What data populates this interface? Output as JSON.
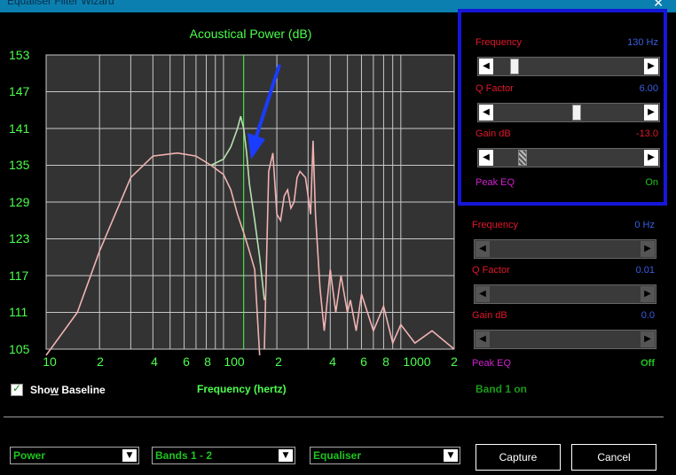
{
  "window": {
    "title": "Equaliser Filter Wizard",
    "close": "✕"
  },
  "chart": {
    "title": "Acoustical Power (dB)",
    "xlabel": "Frequency (hertz)",
    "yticks": [
      "153",
      "147",
      "141",
      "135",
      "129",
      "123",
      "117",
      "111",
      "105"
    ],
    "xticks": [
      "10",
      "2",
      "4",
      "6",
      "8",
      "100",
      "2",
      "4",
      "6",
      "8",
      "1000",
      "2"
    ]
  },
  "chart_data": {
    "type": "line",
    "title": "Acoustical Power (dB)",
    "xlabel": "Frequency (hertz)",
    "ylabel": "",
    "x_scale": "log",
    "xlim": [
      10,
      2000
    ],
    "ylim": [
      105,
      153
    ],
    "grid": true,
    "marker_frequency": 130,
    "series": [
      {
        "color": "#f2b2b2",
        "x": [
          10,
          15,
          20,
          30,
          40,
          55,
          70,
          85,
          100,
          110,
          120,
          130,
          140,
          150,
          160
        ],
        "y": [
          104,
          111,
          121,
          133,
          136.5,
          137,
          136.5,
          135,
          133.5,
          131,
          127,
          124,
          121,
          118,
          104
        ]
      },
      {
        "color": "#b8e0b0",
        "x": [
          85,
          100,
          110,
          120,
          125,
          130,
          135,
          140,
          150,
          160,
          170
        ],
        "y": [
          135,
          136,
          138,
          141,
          143,
          141,
          137,
          132,
          126,
          120,
          113
        ]
      },
      {
        "color": "#f2b2b2",
        "x": [
          170,
          180,
          190,
          200,
          210,
          220,
          230,
          240,
          250,
          260,
          270,
          290,
          300,
          310,
          320,
          330,
          350,
          370,
          400,
          430,
          460,
          500,
          520,
          560,
          600,
          700,
          800,
          900,
          1000,
          1200,
          1500,
          2000
        ],
        "y": [
          105,
          134,
          137,
          127,
          126,
          130,
          131,
          128,
          129,
          133,
          134,
          133,
          130,
          127,
          139,
          127,
          115,
          108,
          118,
          111,
          117,
          111,
          113,
          108,
          114,
          108,
          112,
          106,
          109,
          106,
          108,
          105
        ]
      }
    ]
  },
  "baseline": {
    "label_pre": "Sho",
    "label_u": "w",
    "label_post": " Baseline",
    "checked": true
  },
  "band1_status": "Band 1 on",
  "band1": {
    "frequency_label": "Frequency",
    "frequency_value": "130 Hz",
    "q_label": "Q Factor",
    "q_value": "6.00",
    "gain_label": "Gain  dB",
    "gain_value": "-13.0",
    "type_label": "Peak EQ",
    "state": "On",
    "frequency_slider": 0.12,
    "q_slider": 0.55,
    "gain_slider": 0.17
  },
  "band2": {
    "frequency_label": "Frequency",
    "frequency_value": "0 Hz",
    "q_label": "Q Factor",
    "q_value": "0.01",
    "gain_label": "Gain  dB",
    "gain_value": "0.0",
    "type_label": "Peak EQ",
    "state": "Off"
  },
  "controls": {
    "mode": "Power",
    "bands": "Bands 1 - 2",
    "filter": "Equaliser",
    "capture": "Capture",
    "cancel": "Cancel"
  },
  "colors": {
    "accent": "#4cff4c",
    "panel_border": "#1616d8",
    "plot_bg": "#333333",
    "grid": "#c8c8c8",
    "curve": "#f2b2b2",
    "marker": "#4cff4c"
  }
}
